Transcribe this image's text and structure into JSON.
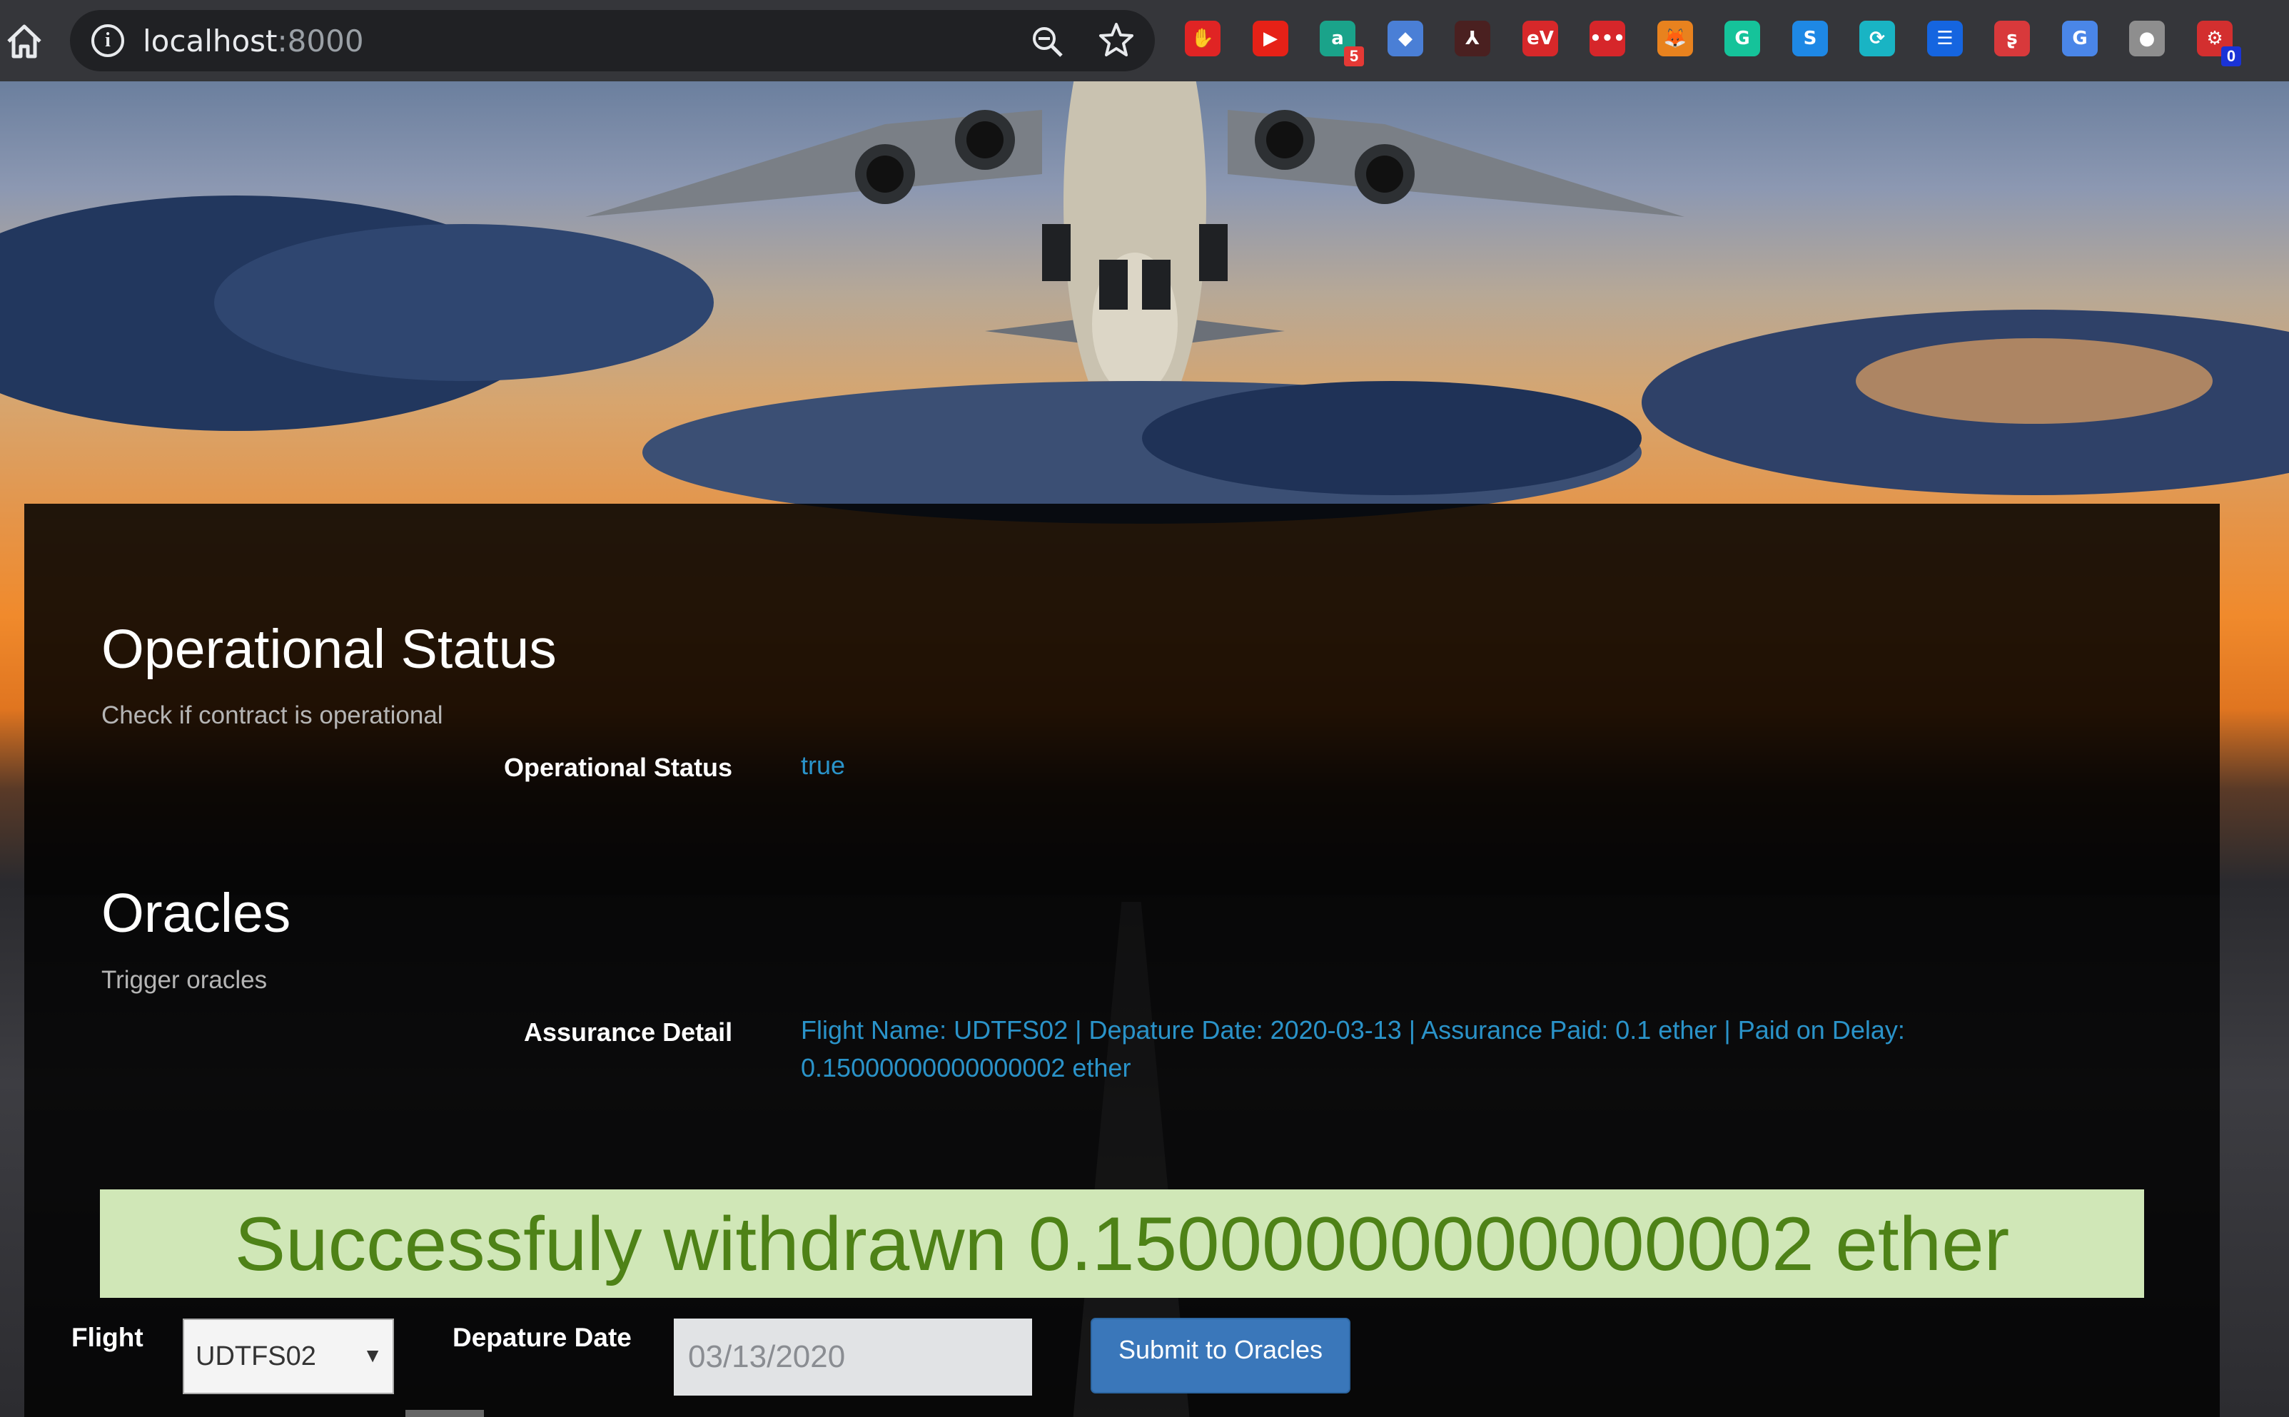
{
  "browser": {
    "url_host": "localhost",
    "url_port": ":8000",
    "extensions": [
      {
        "icon": "ublock-hand-icon",
        "color": "#e02424",
        "glyph": "✋",
        "badge": ""
      },
      {
        "icon": "youtube-icon",
        "color": "#e62117",
        "glyph": "▶",
        "badge": ""
      },
      {
        "icon": "grammar-a-icon",
        "color": "#1aa38a",
        "glyph": "a",
        "badge": "5"
      },
      {
        "icon": "graduation-cap-icon",
        "color": "#4a7fd6",
        "glyph": "◆",
        "badge": ""
      },
      {
        "icon": "pdf-icon",
        "color": "#4a2020",
        "glyph": "⅄",
        "badge": ""
      },
      {
        "icon": "ev-icon",
        "color": "#d7282a",
        "glyph": "eV",
        "badge": ""
      },
      {
        "icon": "dots-icon",
        "color": "#d6262a",
        "glyph": "•••",
        "badge": ""
      },
      {
        "icon": "metamask-fox-icon",
        "color": "#e8821e",
        "glyph": "🦊",
        "badge": ""
      },
      {
        "icon": "grammarly-icon",
        "color": "#15c39a",
        "glyph": "G",
        "badge": ""
      },
      {
        "icon": "s-square-icon",
        "color": "#1e88e5",
        "glyph": "S",
        "badge": ""
      },
      {
        "icon": "sync-icon",
        "color": "#19b4c4",
        "glyph": "⟳",
        "badge": ""
      },
      {
        "icon": "e-circle-icon",
        "color": "#1565e0",
        "glyph": "☰",
        "badge": ""
      },
      {
        "icon": "red-s-icon",
        "color": "#d8393b",
        "glyph": "ʂ",
        "badge": ""
      },
      {
        "icon": "translate-icon",
        "color": "#4a86e8",
        "glyph": "G",
        "badge": ""
      },
      {
        "icon": "grey-circle-icon",
        "color": "#8e8e8e",
        "glyph": "●",
        "badge": ""
      },
      {
        "icon": "red-gear-icon",
        "color": "#d32f2f",
        "glyph": "⚙",
        "badge": "0"
      }
    ]
  },
  "operational": {
    "title": "Operational Status",
    "subtitle": "Check if contract is operational",
    "label": "Operational Status",
    "value": "true"
  },
  "oracles": {
    "title": "Oracles",
    "subtitle": "Trigger oracles",
    "label": "Assurance Detail",
    "value_line1": "Flight Name: UDTFS02 | Depature Date: 2020-03-13 | Assurance Paid: 0.1 ether | Paid on Delay:",
    "value_line2": "0.15000000000000002 ether"
  },
  "alert": {
    "message": "Successfuly withdrawn 0.15000000000000002 ether",
    "background": "#d0e7b7",
    "color": "#4e8217"
  },
  "form": {
    "flight_label": "Flight",
    "flight_value": "UDTFS02",
    "date_label": "Depature Date",
    "date_value": "03/13/2020",
    "submit_label": "Submit to Oracles"
  },
  "colors": {
    "link_blue": "#2a93c9",
    "button_blue": "#3a77ba"
  }
}
